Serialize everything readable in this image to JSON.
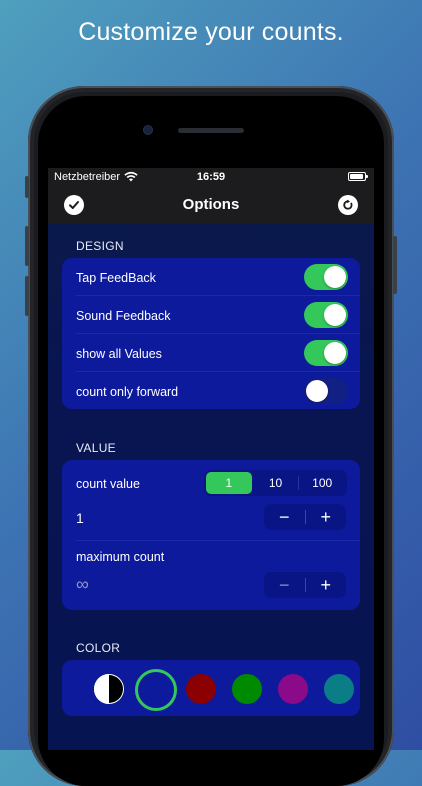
{
  "headline": "Customize your counts.",
  "status_bar": {
    "carrier": "Netzbetreiber",
    "time": "16:59"
  },
  "nav": {
    "title": "Options",
    "confirm_icon": "checkmark-icon",
    "reset_icon": "reset-icon"
  },
  "design": {
    "header": "DESIGN",
    "rows": [
      {
        "label": "Tap FeedBack",
        "on": true
      },
      {
        "label": "Sound Feedback",
        "on": true
      },
      {
        "label": "show all Values",
        "on": true
      },
      {
        "label": "count only forward",
        "on": false
      }
    ]
  },
  "value": {
    "header": "VALUE",
    "count_value_label": "count value",
    "segments": [
      "1",
      "10",
      "100"
    ],
    "selected_segment": "1",
    "current_value": "1",
    "maximum_label": "maximum count",
    "maximum_value": "∞",
    "minus": "−",
    "plus": "+"
  },
  "color": {
    "header": "COLOR",
    "swatches": [
      {
        "name": "black-white",
        "color": "#ffffff",
        "color2": "#000000"
      },
      {
        "name": "navy",
        "color": "#0d1a9c",
        "selected": true
      },
      {
        "name": "dark-red",
        "color": "#8b0000"
      },
      {
        "name": "green",
        "color": "#008a00"
      },
      {
        "name": "purple",
        "color": "#8a0a8a"
      },
      {
        "name": "teal",
        "color": "#0a7d86"
      }
    ],
    "selected_ring": "#34c759"
  },
  "colors": {
    "toggle_on": "#34c759",
    "group_bg": "#0d1a9c",
    "navbar_bg": "#1c1c1e"
  }
}
